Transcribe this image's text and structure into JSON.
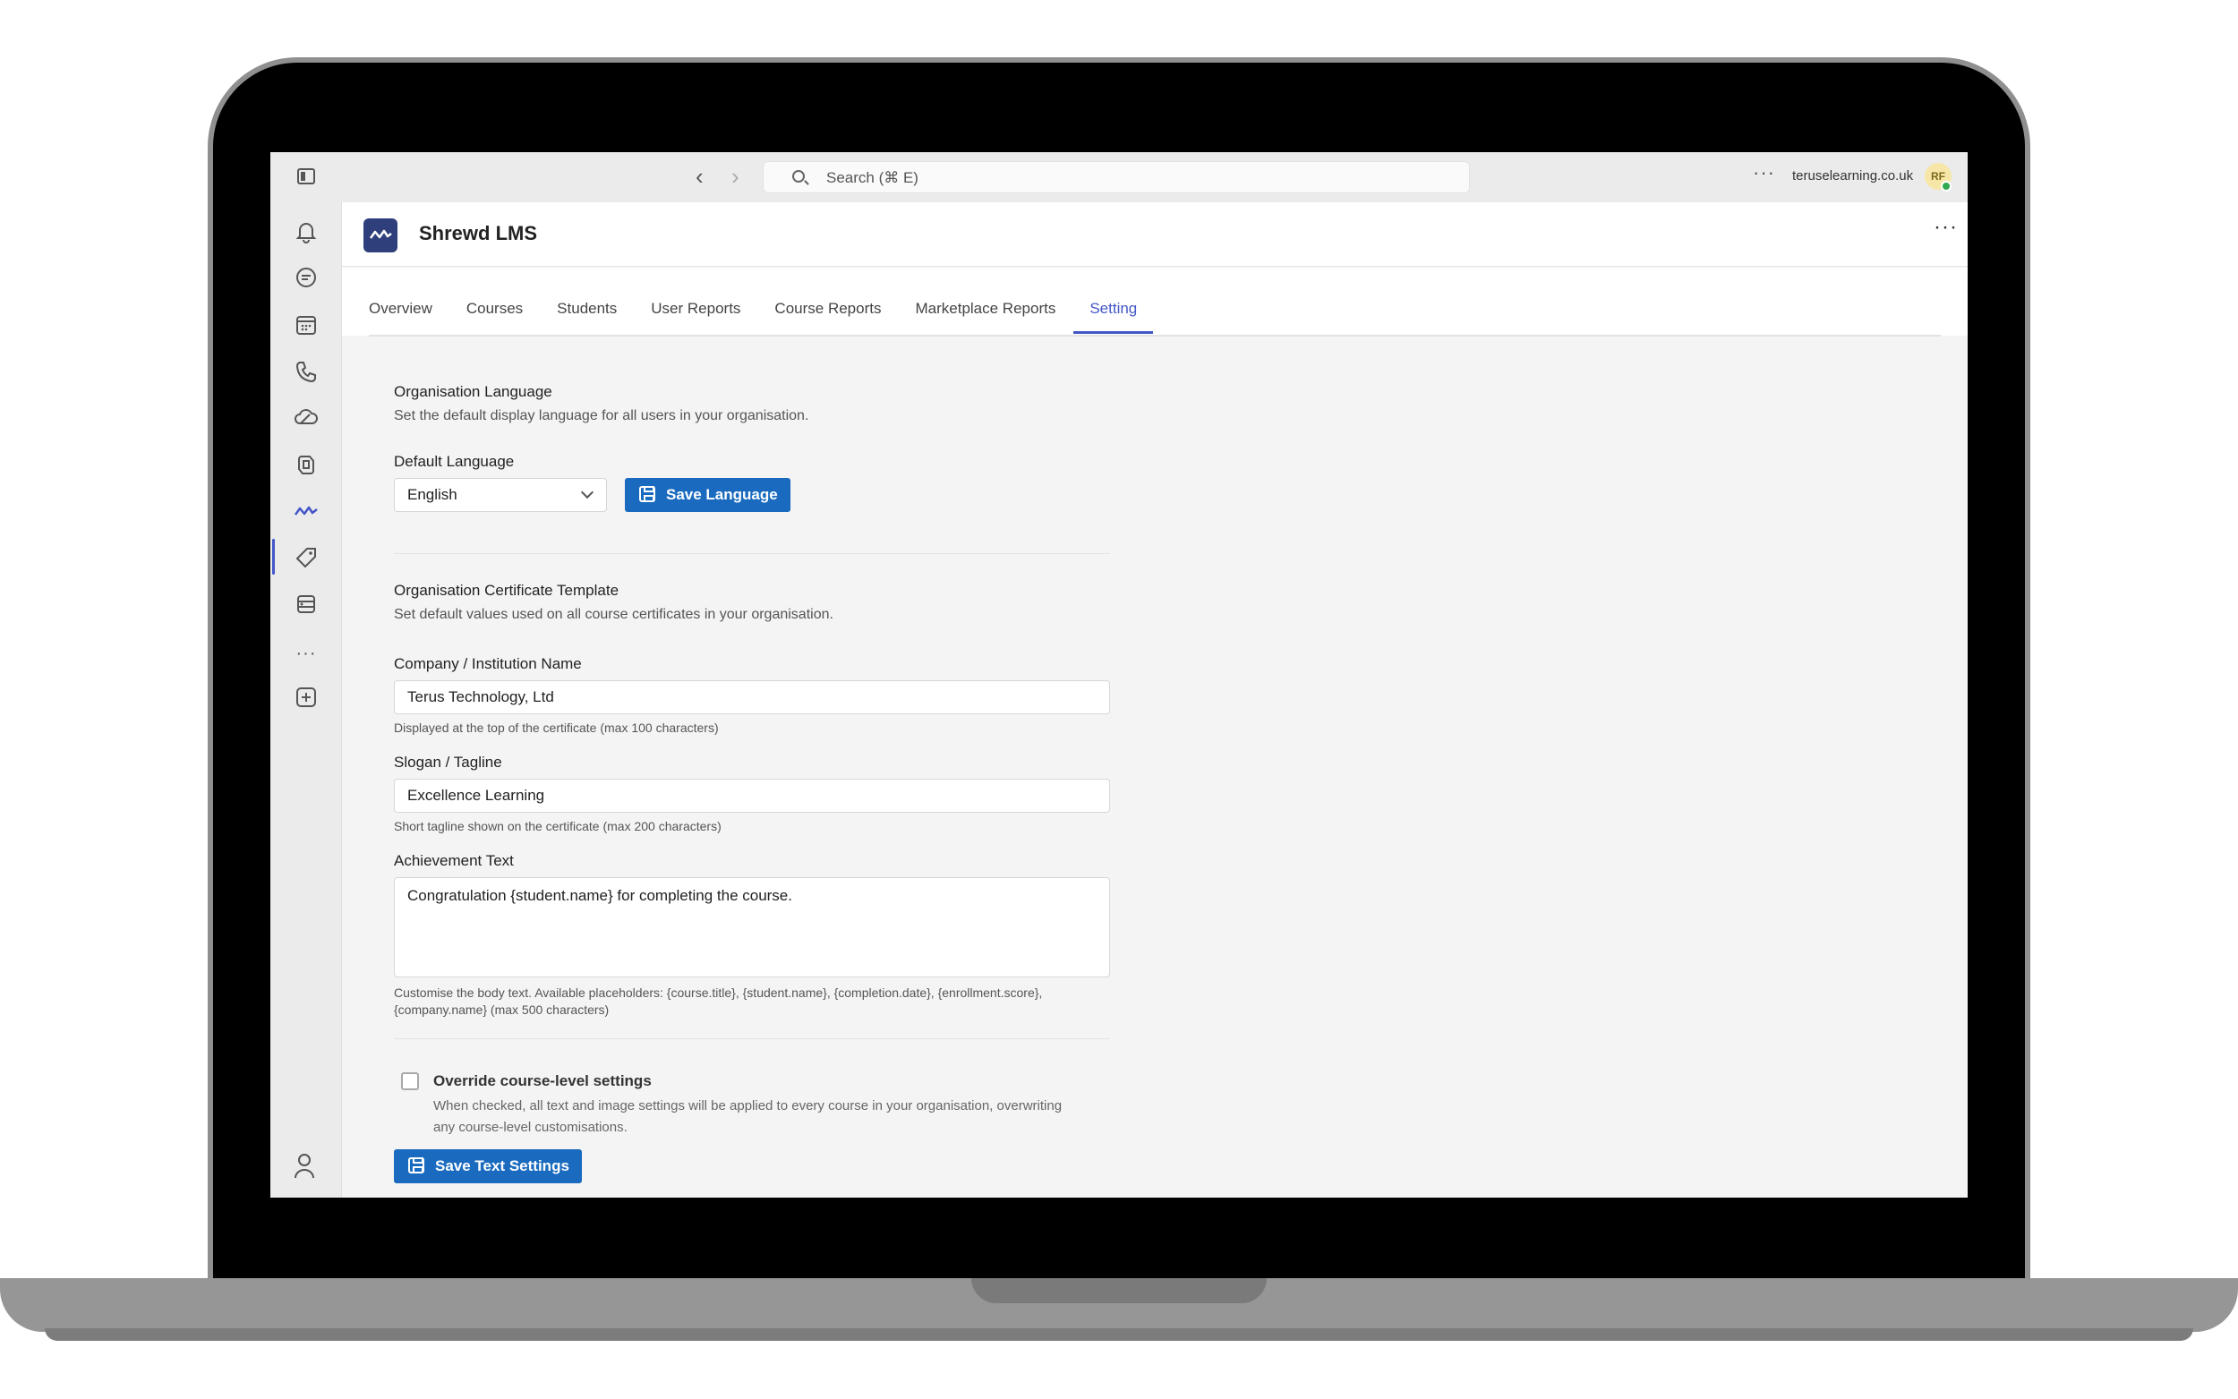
{
  "browser": {
    "search_placeholder": "Search (⌘ E)",
    "domain": "teruselearning.co.uk",
    "avatar_initials": "RF",
    "more_label": "···"
  },
  "rail": {
    "items": [
      "bell-icon",
      "chat-icon",
      "calendar-icon",
      "phone-icon",
      "cloud-icon",
      "copilot-icon",
      "activity-icon",
      "tag-icon",
      "database-icon",
      "more-icon",
      "add-app-icon"
    ],
    "active_index": 6,
    "active_color": "#4356c8"
  },
  "app": {
    "title": "Shrewd LMS",
    "more_label": "···",
    "brand_color": "#2e3f7c"
  },
  "tabs": [
    {
      "label": "Overview",
      "active": false
    },
    {
      "label": "Courses",
      "active": false
    },
    {
      "label": "Students",
      "active": false
    },
    {
      "label": "User Reports",
      "active": false
    },
    {
      "label": "Course Reports",
      "active": false
    },
    {
      "label": "Marketplace Reports",
      "active": false
    },
    {
      "label": "Setting",
      "active": true
    }
  ],
  "language_section": {
    "title": "Organisation Language",
    "subtitle": "Set the default display language for all users in your organisation.",
    "field_label": "Default Language",
    "selected_value": "English",
    "save_button": "Save Language"
  },
  "certificate_section": {
    "title": "Organisation Certificate Template",
    "subtitle": "Set default values used on all course certificates in your organisation.",
    "company_label": "Company / Institution Name",
    "company_value": "Terus Technology, Ltd",
    "company_hint": "Displayed at the top of the certificate (max 100 characters)",
    "slogan_label": "Slogan / Tagline",
    "slogan_value": "Excellence Learning",
    "slogan_hint": "Short tagline shown on the certificate (max 200 characters)",
    "achievement_label": "Achievement Text",
    "achievement_value": "Congratulation {student.name} for completing the course.",
    "achievement_hint": "Customise the body text. Available placeholders: {course.title}, {student.name}, {completion.date}, {enrollment.score}, {company.name} (max 500 characters)",
    "override_label": "Override course-level settings",
    "override_checked": false,
    "override_desc": "When checked, all text and image settings will be applied to every course in your organisation, overwriting any course-level customisations.",
    "save_button": "Save Text Settings",
    "button_color": "#1a6bbf"
  }
}
